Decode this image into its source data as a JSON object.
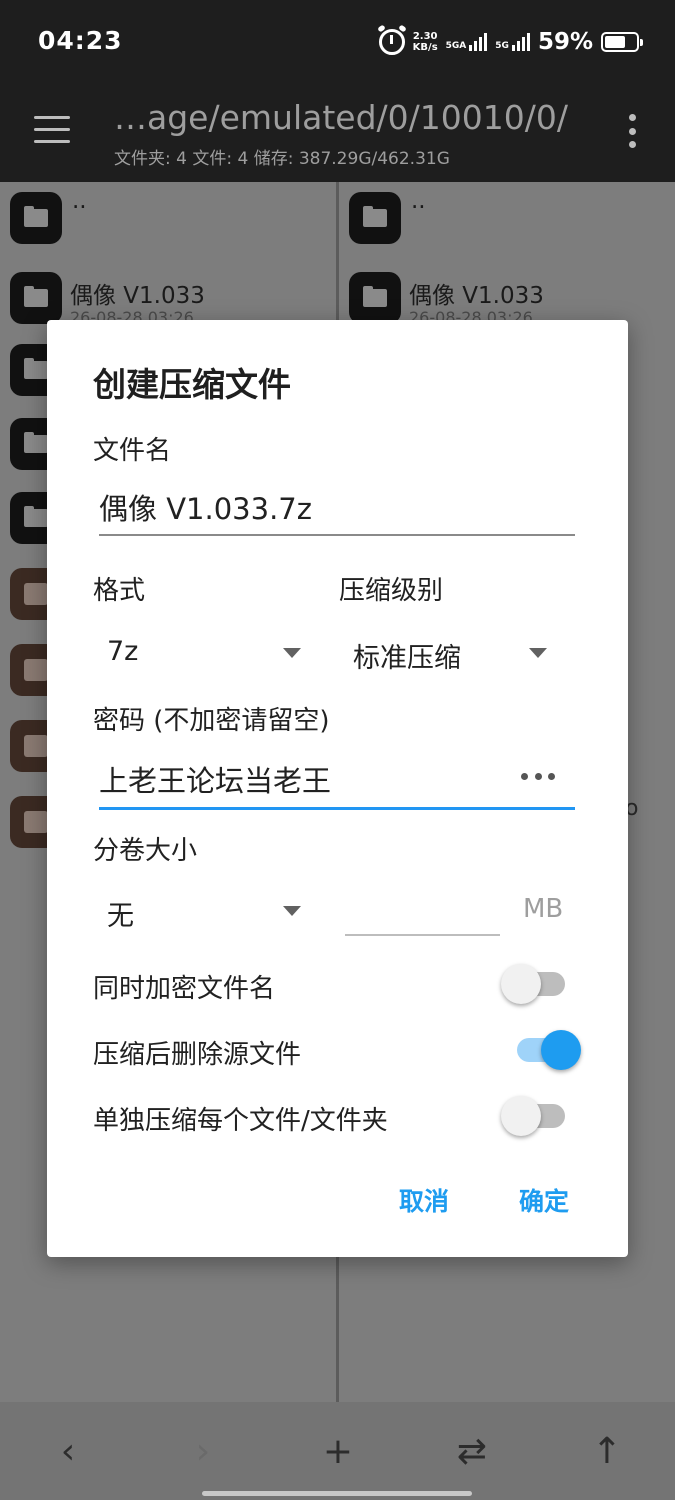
{
  "status_bar": {
    "time": "04:23",
    "speed_value": "2.30",
    "speed_unit": "KB/s",
    "net1": "5GA",
    "net2": "5G",
    "battery": "59%"
  },
  "app_bar": {
    "path": "…age/emulated/0/10010/0/",
    "info": "文件夹: 4  文件: 4  储存: 387.29G/462.31G"
  },
  "left_pane": {
    "parent": "..",
    "items": [
      {
        "name": "偶像 V1.033",
        "date": "26-08-28 03:26"
      }
    ]
  },
  "right_pane": {
    "parent": "..",
    "items": [
      {
        "name": "偶像 V1.033",
        "date": "26-08-28 03:26"
      }
    ],
    "stray_char": "o"
  },
  "dialog": {
    "title": "创建压缩文件",
    "filename_label": "文件名",
    "filename_value": "偶像 V1.033.7z",
    "format_label": "格式",
    "format_value": "7z",
    "level_label": "压缩级别",
    "level_value": "标准压缩",
    "password_label": "密码 (不加密请留空)",
    "password_value": "上老王论坛当老王",
    "volume_label": "分卷大小",
    "volume_value": "无",
    "volume_unit": "MB",
    "encrypt_names_label": "同时加密文件名",
    "encrypt_names_on": false,
    "delete_source_label": "压缩后删除源文件",
    "delete_source_on": true,
    "separate_label": "单独压缩每个文件/文件夹",
    "separate_on": false,
    "cancel": "取消",
    "ok": "确定"
  },
  "bottom_bar": {
    "back": "‹",
    "forward": "›",
    "add": "+",
    "swap": "⇄",
    "up": "↑"
  },
  "accent_color": "#1e9cf0"
}
